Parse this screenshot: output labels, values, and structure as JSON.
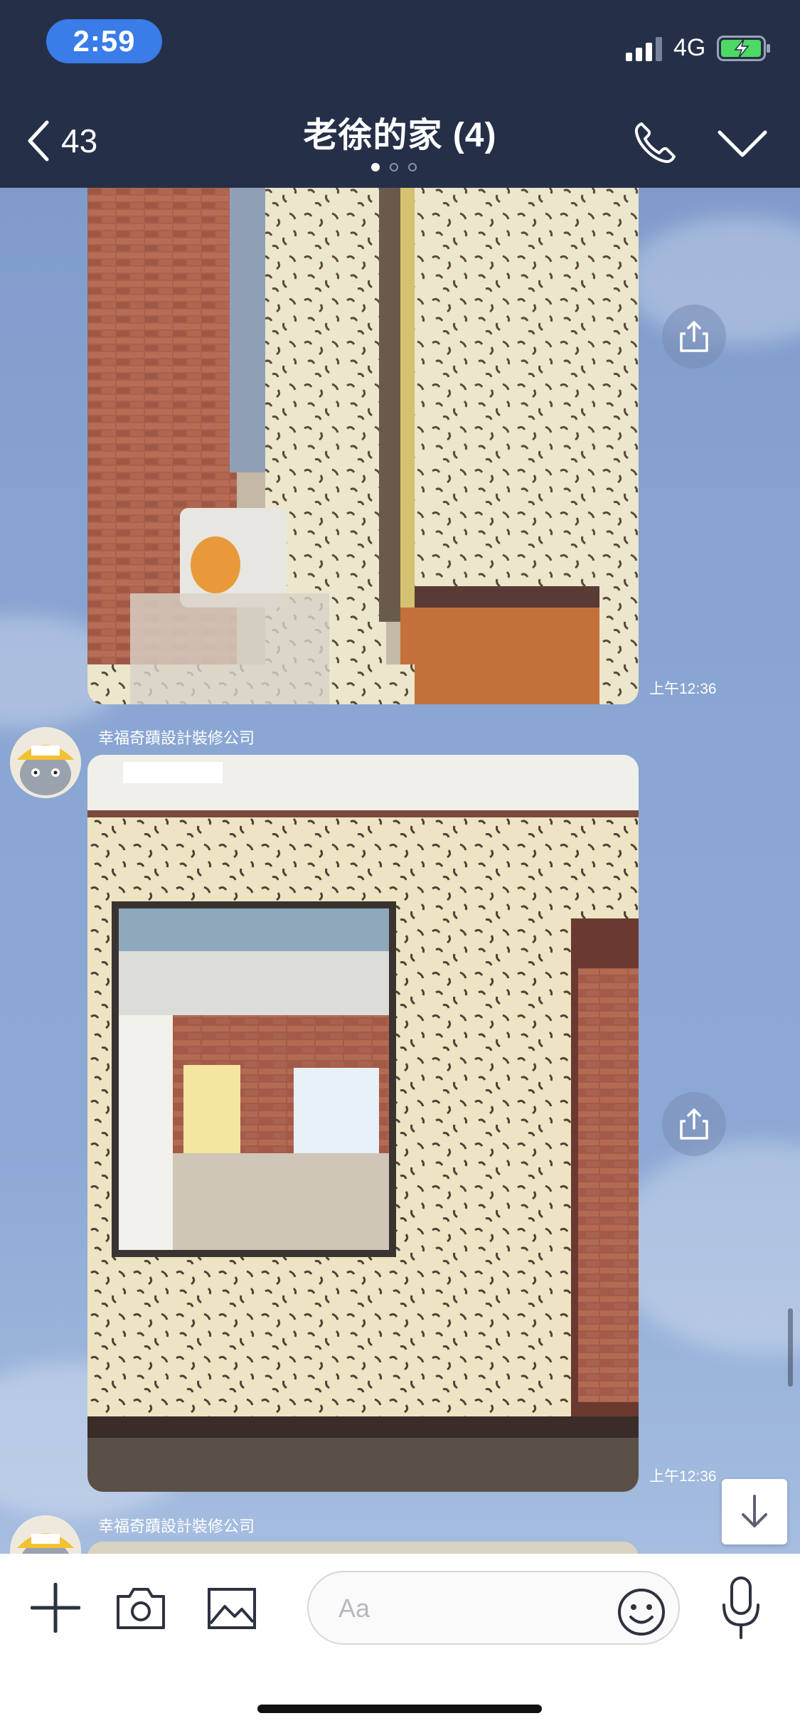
{
  "status_bar": {
    "time": "2:59",
    "network": "4G"
  },
  "header": {
    "back_count": "43",
    "title": "老徐的家 (4)",
    "page_dots": 3,
    "active_page": 1
  },
  "messages": [
    {
      "type": "image",
      "alt": "construction photo with brick wall",
      "time": "上午12:36"
    },
    {
      "sender": "幸福奇蹟設計裝修公司",
      "type": "image",
      "alt": "room wall with opening under renovation",
      "time": "上午12:36"
    },
    {
      "sender": "幸福奇蹟設計裝修公司",
      "type": "image",
      "time": ""
    }
  ],
  "input": {
    "placeholder": "Aa"
  },
  "colors": {
    "header_bg": "#253048",
    "time_pill": "#3a7ce8",
    "chat_bg": "#8aa6d3",
    "battery_green": "#4cd964"
  }
}
